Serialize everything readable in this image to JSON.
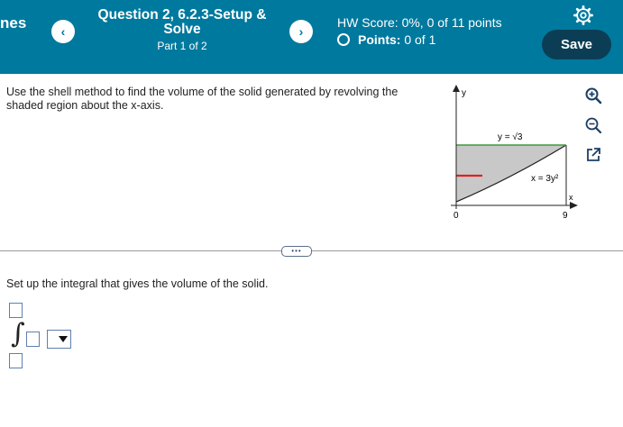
{
  "header": {
    "app_name": "nes",
    "prev_label": "‹",
    "next_label": "›",
    "question_title": "Question 2, 6.2.3-Setup & Solve",
    "question_part": "Part 1 of 2",
    "hw_score": "HW Score: 0%, 0 of 11 points",
    "points_label": "Points:",
    "points_value": "0 of 1",
    "save_label": "Save",
    "icons": {
      "settings": "gear-icon",
      "points": "ring-icon"
    }
  },
  "question": {
    "instructions": "Use the shell method to find the volume of the solid generated by revolving the shaded region about the x-axis."
  },
  "graph": {
    "y_axis_label": "y",
    "x_axis_label": "x",
    "origin_label": "0",
    "x_tick_label": "9",
    "curve_label": "x = 3y²",
    "line_label": "y = √3",
    "colors": {
      "shading": "#c8c8c8",
      "top_line": "#3e9a3e",
      "shell": "#e02020",
      "curve": "#222222"
    }
  },
  "tools": {
    "icons": [
      "zoom-in-icon",
      "zoom-out-icon",
      "open-external-icon"
    ]
  },
  "answer": {
    "prompt": "Set up the integral that gives the volume of the solid.",
    "upper_limit": "",
    "lower_limit": "",
    "integrand": "",
    "integral_symbol": "∫",
    "differential_selected": ""
  },
  "colors": {
    "header_bg": "#00799e",
    "save_bg": "#0b3e55",
    "input_border": "#5f7fb0"
  }
}
